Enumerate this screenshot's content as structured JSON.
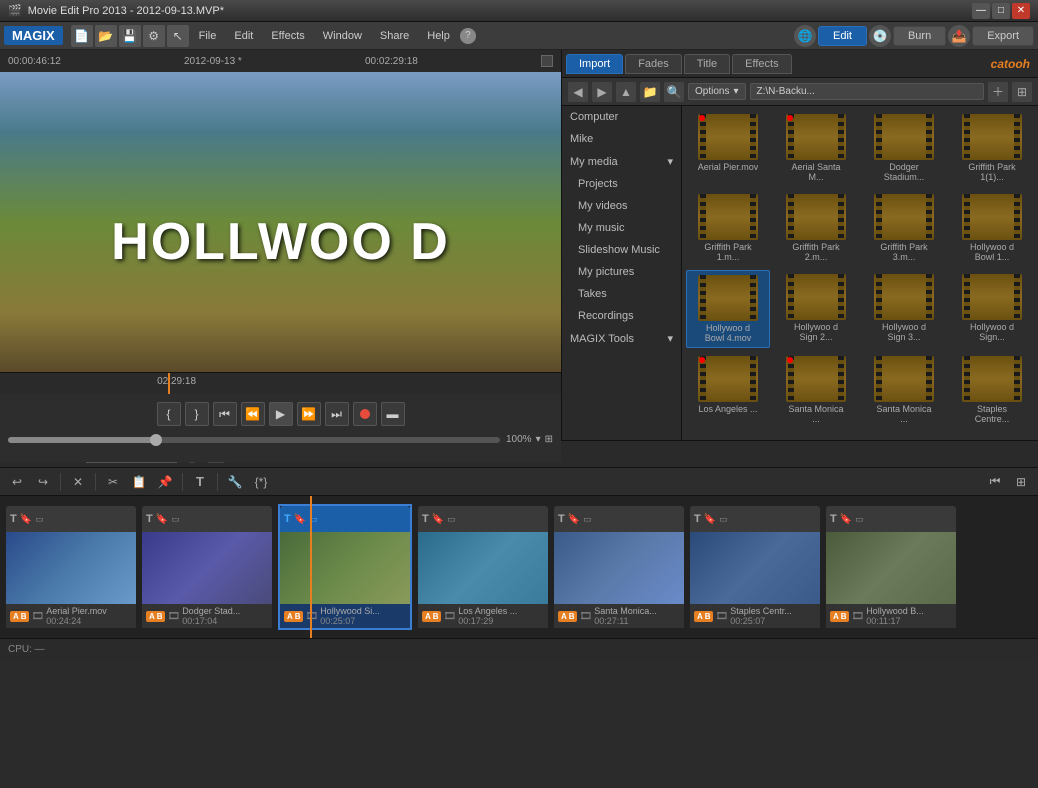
{
  "titlebar": {
    "title": "Movie Edit Pro 2013 - 2012-09-13.MVP*",
    "icon": "🎬",
    "win_min": "—",
    "win_max": "□",
    "win_close": "✕"
  },
  "menubar": {
    "logo": "MAGIX",
    "menus": [
      "File",
      "Edit",
      "Effects",
      "Window",
      "Share",
      "Help"
    ],
    "help_icon": "?",
    "modes": [
      {
        "id": "edit",
        "label": "Edit",
        "active": true
      },
      {
        "id": "burn",
        "label": "Burn",
        "active": false
      },
      {
        "id": "export",
        "label": "Export",
        "active": false
      }
    ]
  },
  "preview": {
    "time_current": "00:00:46:12",
    "time_date": "2012-09-13 *",
    "time_total": "00:02:29:18",
    "timeline_pos": "02:29:18",
    "zoom": "100%"
  },
  "mediabrowser": {
    "tabs": [
      "Import",
      "Fades",
      "Title",
      "Effects"
    ],
    "active_tab": "Import",
    "catooh": "catooh",
    "options_label": "Options",
    "path": "Z:\\N-Backu...",
    "sidebar_items": [
      {
        "id": "computer",
        "label": "Computer"
      },
      {
        "id": "mike",
        "label": "Mike"
      },
      {
        "id": "my-media",
        "label": "My media"
      },
      {
        "id": "projects",
        "label": "Projects"
      },
      {
        "id": "my-videos",
        "label": "My videos"
      },
      {
        "id": "my-music",
        "label": "My music"
      },
      {
        "id": "slideshow-music",
        "label": "Slideshow Music"
      },
      {
        "id": "my-pictures",
        "label": "My pictures"
      },
      {
        "id": "takes",
        "label": "Takes"
      },
      {
        "id": "recordings",
        "label": "Recordings"
      },
      {
        "id": "magix-tools",
        "label": "MAGIX Tools"
      }
    ],
    "files": [
      {
        "name": "Aerial Pier.mov",
        "selected": false,
        "has_red": true
      },
      {
        "name": "Aerial Santa M...",
        "selected": false,
        "has_red": true
      },
      {
        "name": "Dodger Stadium...",
        "selected": false,
        "has_red": false
      },
      {
        "name": "Griffith Park 1(1)...",
        "selected": false,
        "has_red": false
      },
      {
        "name": "Griffith Park 1.m...",
        "selected": false,
        "has_red": false
      },
      {
        "name": "Griffith Park 2.m...",
        "selected": false,
        "has_red": false
      },
      {
        "name": "Griffith Park 3.m...",
        "selected": false,
        "has_red": false
      },
      {
        "name": "Hollywoo d Bowl 1...",
        "selected": false,
        "has_red": false
      },
      {
        "name": "Hollywoo d Bowl 4.mov",
        "selected": true,
        "has_red": false
      },
      {
        "name": "Hollywoo d Sign 2...",
        "selected": false,
        "has_red": false
      },
      {
        "name": "Hollywoo d Sign 3...",
        "selected": false,
        "has_red": false
      },
      {
        "name": "Hollywoo d Sign...",
        "selected": false,
        "has_red": false
      },
      {
        "name": "Los Angeles ...",
        "selected": false,
        "has_red": true
      },
      {
        "name": "Santa Monica ...",
        "selected": false,
        "has_red": true
      },
      {
        "name": "Santa Monica ...",
        "selected": false,
        "has_red": false
      },
      {
        "name": "Staples Centre...",
        "selected": false,
        "has_red": false
      }
    ]
  },
  "timeline": {
    "tab_name": "2012-09-13",
    "clips": [
      {
        "name": "Aerial Pier.mov",
        "time": "00:24:24",
        "selected": false,
        "thumb": "thumb-pier"
      },
      {
        "name": "Dodger Stad...",
        "time": "00:17:04",
        "selected": false,
        "thumb": "thumb-dodger"
      },
      {
        "name": "Hollywood Si...",
        "time": "00:25:07",
        "selected": true,
        "thumb": "thumb-hollywood"
      },
      {
        "name": "Los Angeles ...",
        "time": "00:17:29",
        "selected": false,
        "thumb": "thumb-la"
      },
      {
        "name": "Santa Monica...",
        "time": "00:27:11",
        "selected": false,
        "thumb": "thumb-santa1"
      },
      {
        "name": "Staples Centr...",
        "time": "00:25:07",
        "selected": false,
        "thumb": "thumb-staples"
      },
      {
        "name": "Hollywood B...",
        "time": "00:11:17",
        "selected": false,
        "thumb": "thumb-hbowl"
      }
    ]
  },
  "statusbar": {
    "cpu": "CPU: —"
  }
}
